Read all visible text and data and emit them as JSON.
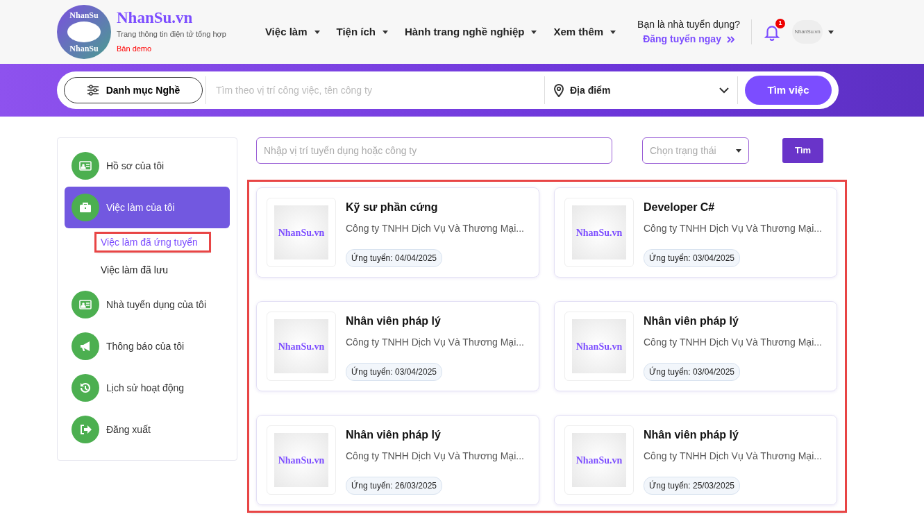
{
  "header": {
    "logo_text_top": "NhanSu",
    "logo_text_bottom": "NhanSu",
    "site_name": "NhanSu.vn",
    "tagline": "Trang thông tin điện tử tổng hợp",
    "badge": "Bản demo",
    "nav": [
      {
        "label": "Việc làm"
      },
      {
        "label": "Tiện ích"
      },
      {
        "label": "Hành trang nghề nghiệp"
      },
      {
        "label": "Xem thêm"
      }
    ],
    "employer_question": "Bạn là nhà tuyển dụng?",
    "employer_link": "Đăng tuyển ngay",
    "notification_count": "1",
    "avatar_text": "NhanSu.vn"
  },
  "search_bar": {
    "category_button": "Danh mục Nghề",
    "keyword_placeholder": "Tìm theo vị trí công việc, tên công ty",
    "location": "Địa điểm",
    "submit": "Tìm việc"
  },
  "sidebar": {
    "items": [
      {
        "label": "Hồ sơ của tôi",
        "kind": "card",
        "selected": false
      },
      {
        "label": "Việc làm của tôi",
        "kind": "briefcase",
        "selected": true,
        "children": [
          {
            "label": "Việc làm đã ứng tuyển",
            "selected": true,
            "highlighted": true
          },
          {
            "label": "Việc làm đã lưu",
            "selected": false,
            "highlighted": false
          }
        ]
      },
      {
        "label": "Nhà tuyển dụng của tôi",
        "kind": "card",
        "selected": false
      },
      {
        "label": "Thông báo của tôi",
        "kind": "megaphone",
        "selected": false
      },
      {
        "label": "Lịch sử hoạt động",
        "kind": "history",
        "selected": false
      },
      {
        "label": "Đăng xuất",
        "kind": "logout",
        "selected": false
      }
    ]
  },
  "filter": {
    "search_placeholder": "Nhập vị trí tuyển dụng hoặc công ty",
    "status_placeholder": "Chọn trạng thái",
    "submit": "Tìm"
  },
  "jobs_highlighted": true,
  "jobs": [
    {
      "title": "Kỹ sư phần cứng",
      "company": "Công ty TNHH Dịch Vụ Và Thương Mại...",
      "thumb_text": "NhanSu.vn",
      "applied": "Ứng tuyển: 04/04/2025"
    },
    {
      "title": "Developer C#",
      "company": "Công ty TNHH Dịch Vụ Và Thương Mại...",
      "thumb_text": "NhanSu.vn",
      "applied": "Ứng tuyển: 03/04/2025"
    },
    {
      "title": "Nhân viên pháp lý",
      "company": "Công ty TNHH Dịch Vụ Và Thương Mại...",
      "thumb_text": "NhanSu.vn",
      "applied": "Ứng tuyển: 03/04/2025"
    },
    {
      "title": "Nhân viên pháp lý",
      "company": "Công ty TNHH Dịch Vụ Và Thương Mại...",
      "thumb_text": "NhanSu.vn",
      "applied": "Ứng tuyển: 03/04/2025"
    },
    {
      "title": "Nhân viên pháp lý",
      "company": "Công ty TNHH Dịch Vụ Và Thương Mại...",
      "thumb_text": "NhanSu.vn",
      "applied": "Ứng tuyển: 26/03/2025"
    },
    {
      "title": "Nhân viên pháp lý",
      "company": "Công ty TNHH Dịch Vụ Và Thương Mại...",
      "thumb_text": "NhanSu.vn",
      "applied": "Ứng tuyển: 25/03/2025"
    }
  ]
}
